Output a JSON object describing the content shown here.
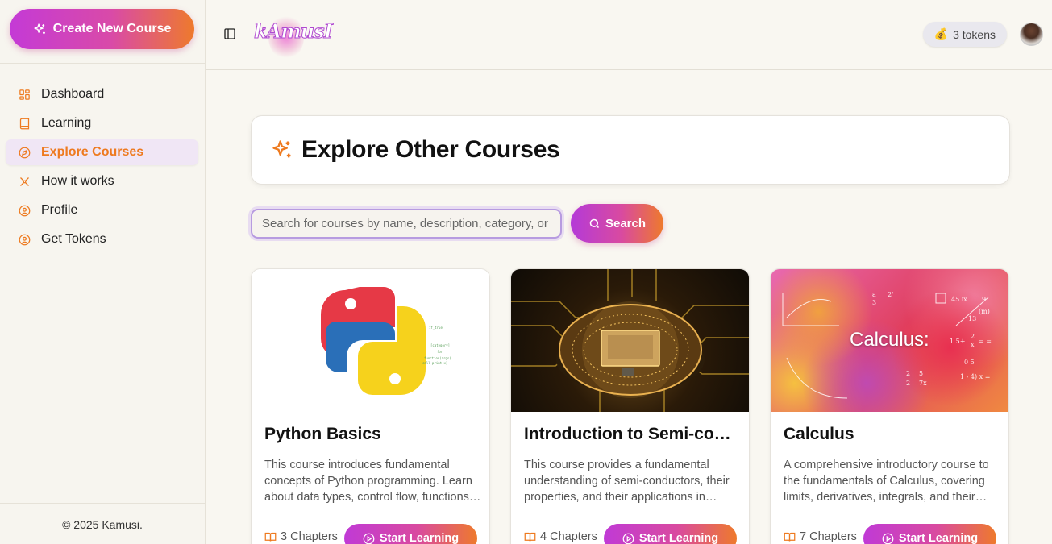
{
  "sidebar": {
    "create_button_label": "Create New Course",
    "items": [
      {
        "label": "Dashboard"
      },
      {
        "label": "Learning"
      },
      {
        "label": "Explore Courses"
      },
      {
        "label": "How it works"
      },
      {
        "label": "Profile"
      },
      {
        "label": "Get Tokens"
      }
    ],
    "active_item": "Explore Courses",
    "copyright": "© 2025 Kamusi."
  },
  "header": {
    "logo_text": "kAmusI",
    "tokens_label": "3 tokens",
    "tokens_icon": "money-bag-icon"
  },
  "main": {
    "title": "Explore Other Courses",
    "search": {
      "placeholder": "Search for courses by name, description, category, or",
      "button_label": "Search"
    },
    "courses": [
      {
        "title": "Python Basics",
        "description": "This course introduces fundamental concepts of Python programming. Learn about data types, control flow, functions and more.",
        "chapters": "3 Chapters",
        "button_label": "Start Learning"
      },
      {
        "title": "Introduction to Semi-conductors",
        "description": "This course provides a fundamental understanding of semi-conductors, their properties, and their applications in modern electronics.",
        "chapters": "4 Chapters",
        "button_label": "Start Learning"
      },
      {
        "title": "Calculus",
        "description": "A comprehensive introductory course to the fundamentals of Calculus, covering limits, derivatives, integrals, and their applications.",
        "chapters": "7 Chapters",
        "button_label": "Start Learning",
        "image_text": "Calculus:"
      }
    ]
  },
  "colors": {
    "accent_orange": "#ee7a1f",
    "gradient_start": "#c43ad6",
    "gradient_end": "#ee7a2c",
    "background": "#f9f7f1"
  }
}
